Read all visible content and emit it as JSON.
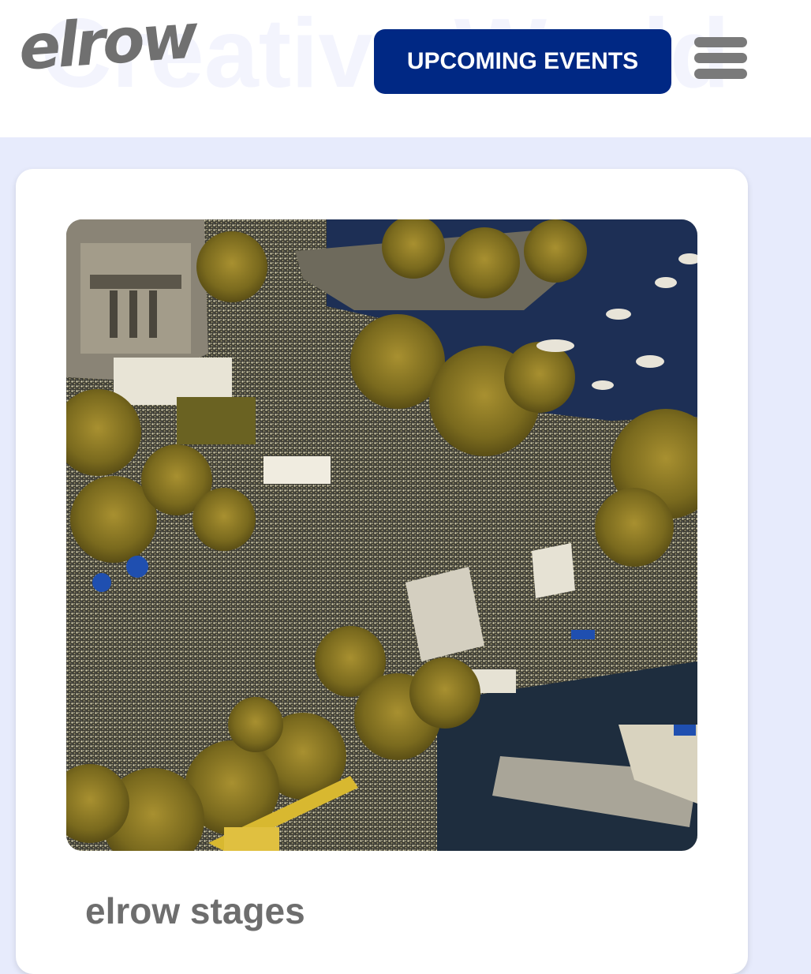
{
  "header": {
    "logo_text": "elrow",
    "background_text": "Our\nCreative World",
    "cta_label": "UPCOMING EVENTS",
    "menu_icon": "hamburger-menu-icon"
  },
  "card": {
    "image_subject": "aerial view of a festival crowd by the lake",
    "title": "elrow stages"
  },
  "colors": {
    "page_background": "#e7ebfc",
    "brand_blue": "#002884",
    "logo_gray": "#707070",
    "title_gray": "#6e6e6e",
    "card_background": "#ffffff"
  }
}
